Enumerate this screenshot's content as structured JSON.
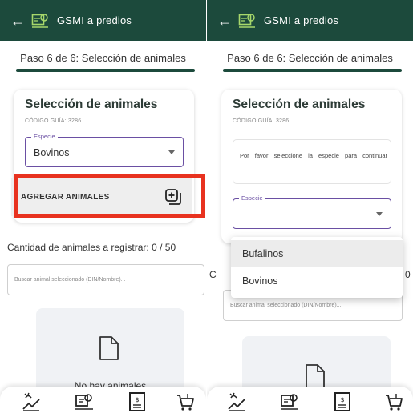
{
  "app": {
    "title": "GSMI a predios",
    "step": "Paso 6 de 6: Selección de animales"
  },
  "left": {
    "card_title": "Selección de animales",
    "card_sub": "CÓDIGO GUÍA: 3286",
    "species_legend": "Especie",
    "species_value": "Bovinos",
    "add_label": "AGREGAR ANIMALES",
    "count_label": "Cantidad de animales a registrar: 0 / 50",
    "search_placeholder": "Buscar animal seleccionado (DIN/Nombre)...",
    "empty_text": "No hay animales"
  },
  "right": {
    "card_title": "Selección de animales",
    "card_sub": "CÓDIGO GUÍA: 3286",
    "info_text": "Por favor seleccione la especie para continuar",
    "species_legend": "Especie",
    "species_value": "",
    "count_partial_left": "C",
    "count_partial_right": "0",
    "search_placeholder": "Buscar animal seleccionado (DIN/Nombre)...",
    "dropdown_options": [
      "Bufalinos",
      "Bovinos"
    ]
  },
  "bottom_nav": [
    "livestock-icon",
    "property-badge-icon",
    "document-icon",
    "cart-icon"
  ],
  "colors": {
    "primary": "#1c4a3c",
    "accent": "#6a4fa3",
    "highlight": "#e8321f"
  }
}
